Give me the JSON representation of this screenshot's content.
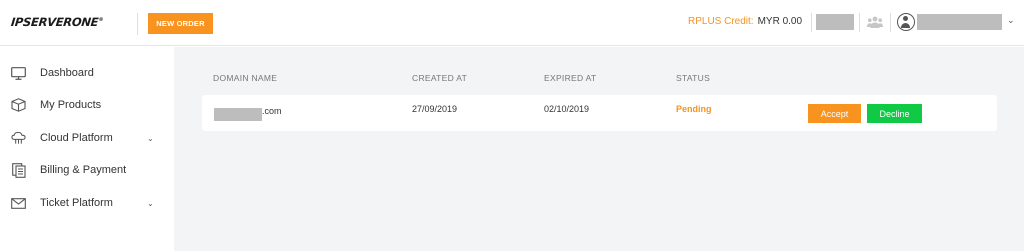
{
  "header": {
    "logo_text": "IPSERVERONE",
    "logo_tm": "®",
    "new_order_label": "NEW ORDER",
    "credit_label": "RPLUS Credit:",
    "credit_value": "MYR 0.00"
  },
  "sidebar": {
    "items": [
      {
        "label": "Dashboard",
        "icon": "monitor-icon",
        "has_submenu": false
      },
      {
        "label": "My Products",
        "icon": "box-icon",
        "has_submenu": false
      },
      {
        "label": "Cloud Platform",
        "icon": "cloud-icon",
        "has_submenu": true
      },
      {
        "label": "Billing & Payment",
        "icon": "billing-icon",
        "has_submenu": false
      },
      {
        "label": "Ticket Platform",
        "icon": "envelope-icon",
        "has_submenu": true
      }
    ],
    "chevron": "⌄"
  },
  "table": {
    "columns": [
      "DOMAIN NAME",
      "CREATED AT",
      "EXPIRED AT",
      "STATUS"
    ],
    "rows": [
      {
        "domain_suffix": ".com",
        "created_at": "27/09/2019",
        "expired_at": "02/10/2019",
        "status": "Pending",
        "accept_label": "Accept",
        "decline_label": "Decline"
      }
    ]
  },
  "colors": {
    "accent": "#f7931e",
    "success": "#10c945",
    "background": "#f2f4f6"
  }
}
